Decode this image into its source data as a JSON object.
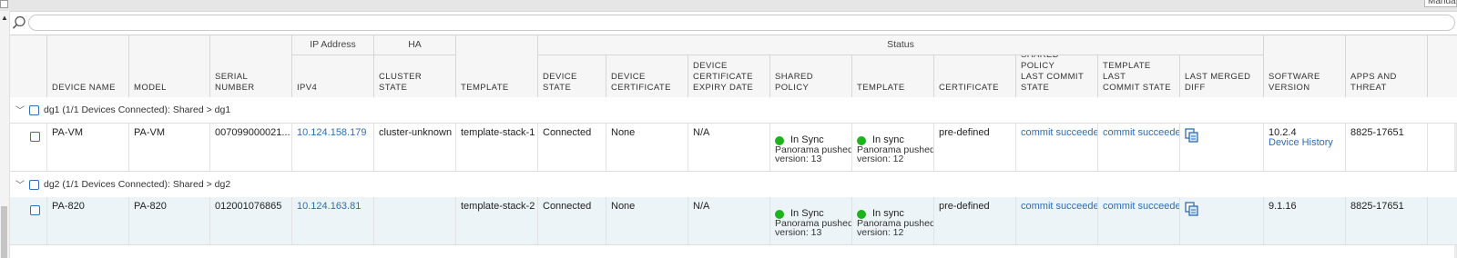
{
  "top": {
    "manual_label": "Manual"
  },
  "search": {
    "value": "",
    "placeholder": ""
  },
  "header": {
    "groups": {
      "ip_address": "IP Address",
      "ha": "HA",
      "status": "Status"
    },
    "columns": {
      "device_name": "DEVICE NAME",
      "model": "MODEL",
      "serial_number": "SERIAL NUMBER",
      "ipv4": "IPV4",
      "cluster_state": "CLUSTER STATE",
      "template": "TEMPLATE",
      "device_state_1": "DEVICE",
      "device_state_2": "STATE",
      "device_cert_1": "DEVICE",
      "device_cert_2": "CERTIFICATE",
      "cert_expiry_1": "DEVICE",
      "cert_expiry_2": "CERTIFICATE",
      "cert_expiry_3": "EXPIRY DATE",
      "shared_policy": "SHARED POLICY",
      "status_template": "TEMPLATE",
      "certificate": "CERTIFICATE",
      "spl_1": "SHARED POLICY",
      "spl_2": "LAST COMMIT",
      "spl_3": "STATE",
      "tlc_1": "TEMPLATE LAST",
      "tlc_2": "COMMIT STATE",
      "lmd_1": "LAST MERGED",
      "lmd_2": "DIFF",
      "sv_1": "SOFTWARE",
      "sv_2": "VERSION",
      "at_1": "APPS AND",
      "at_2": "THREAT"
    }
  },
  "groups": [
    {
      "label": "dg1 (1/1 Devices Connected): Shared > dg1",
      "device": {
        "device_name": "PA-VM",
        "model": "PA-VM",
        "serial_number": "007099000021...",
        "ipv4": "10.124.158.179",
        "cluster_state": "cluster-unknown",
        "template": "template-stack-1",
        "device_state": "Connected",
        "device_certificate": "None",
        "cert_expiry": "N/A",
        "shared_policy_status": "In Sync",
        "shared_policy_sub1": "Panorama pushed",
        "shared_policy_sub2": "version: 13",
        "template_status": "In sync",
        "template_sub1": "Panorama pushed",
        "template_sub2": "version: 12",
        "certificate": "pre-defined",
        "shared_policy_commit": "commit succeeded",
        "template_commit": "commit succeeded",
        "software_version": "10.2.4",
        "device_history": "Device History",
        "apps_threat": "8825-17651"
      }
    },
    {
      "label": "dg2 (1/1 Devices Connected): Shared > dg2",
      "device": {
        "device_name": "PA-820",
        "model": "PA-820",
        "serial_number": "012001076865",
        "ipv4": "10.124.163.81",
        "cluster_state": "",
        "template": "template-stack-2",
        "device_state": "Connected",
        "device_certificate": "None",
        "cert_expiry": "N/A",
        "shared_policy_status": "In Sync",
        "shared_policy_sub1": "Panorama pushed",
        "shared_policy_sub2": "version: 13",
        "template_status": "In sync",
        "template_sub1": "Panorama pushed",
        "template_sub2": "version: 12",
        "certificate": "pre-defined",
        "shared_policy_commit": "commit succeeded",
        "template_commit": "commit succeeded",
        "software_version": "9.1.16",
        "device_history": "",
        "apps_threat": "8825-17651"
      }
    }
  ],
  "colors": {
    "link": "#2d6db5",
    "in_sync_dot": "#1db31d",
    "row_highlight": "#edf4f8"
  },
  "icons": {
    "search": "search-icon",
    "diff": "merged-diff-icon",
    "chevron": "chevron-down-icon"
  }
}
